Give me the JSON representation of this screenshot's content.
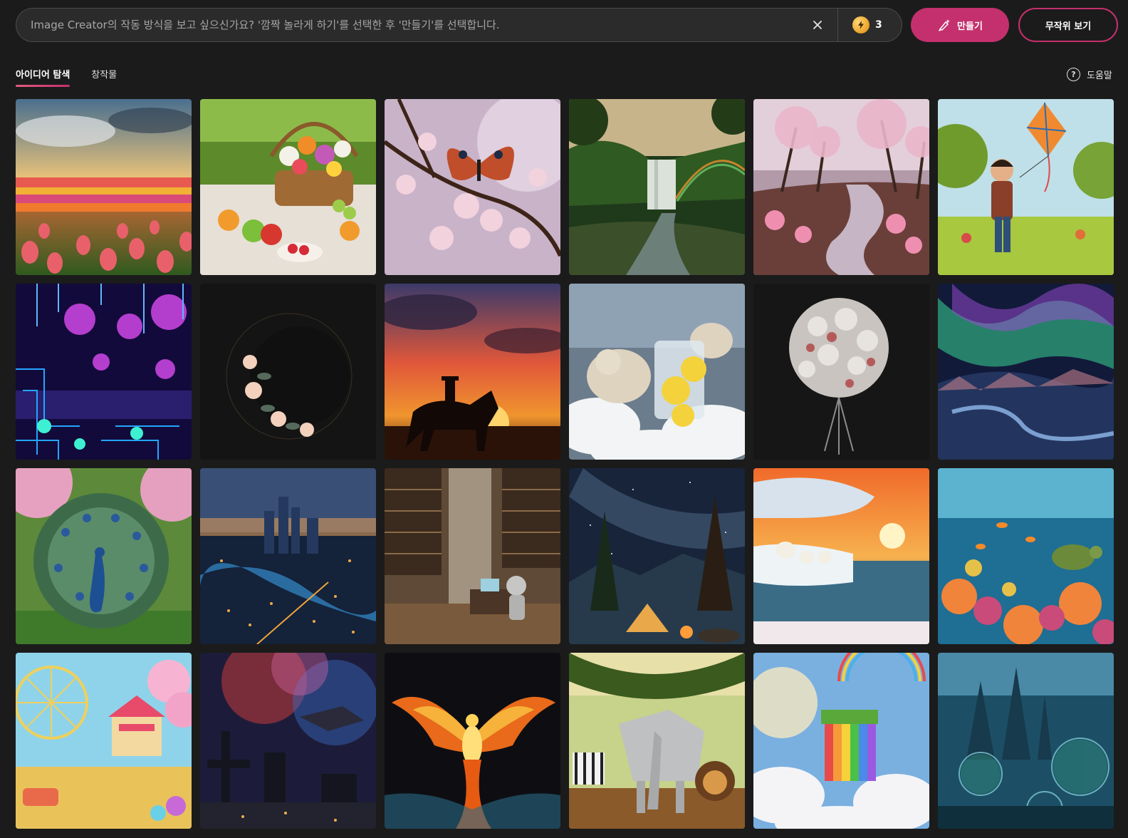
{
  "search": {
    "placeholder": "Image Creator의 작동 방식을 보고 싶으신가요? '깜짝 놀라게 하기'를 선택한 후 '만들기'를 선택합니다.",
    "value": "",
    "clear_icon": "close-icon",
    "boost_icon": "lightning-coin-icon",
    "boost_count": "3"
  },
  "actions": {
    "create_label": "만들기",
    "create_icon": "pen-sparkle-icon",
    "surprise_label": "무작위 보기"
  },
  "tabs": [
    {
      "label": "아이디어 탐색",
      "active": true
    },
    {
      "label": "창작물",
      "active": false
    }
  ],
  "help": {
    "label": "도움말",
    "icon": "question-circle-icon"
  },
  "colors": {
    "background": "#1b1b1b",
    "accent": "#c4306d",
    "bar": "#2b2b2b"
  },
  "gallery": {
    "tiles": [
      {
        "subject": "tulip-field-sunset"
      },
      {
        "subject": "picnic-flower-basket"
      },
      {
        "subject": "butterfly-cherry-blossom"
      },
      {
        "subject": "jungle-waterfall-rainbow"
      },
      {
        "subject": "cherry-blossom-river"
      },
      {
        "subject": "boy-flying-kite"
      },
      {
        "subject": "neon-circuit-garden"
      },
      {
        "subject": "floral-crescent-moon"
      },
      {
        "subject": "cowboy-sunset-silhouette"
      },
      {
        "subject": "polar-bears-lemonade"
      },
      {
        "subject": "metallic-flower-bouquet"
      },
      {
        "subject": "aurora-over-mountains"
      },
      {
        "subject": "peacock-cherry-garden"
      },
      {
        "subject": "city-night-aerial"
      },
      {
        "subject": "robot-library"
      },
      {
        "subject": "milky-way-campsite"
      },
      {
        "subject": "polar-bears-iceberg-sunset"
      },
      {
        "subject": "coral-reef-turtle"
      },
      {
        "subject": "cotton-candy-carnival"
      },
      {
        "subject": "space-city-nebula"
      },
      {
        "subject": "fire-phoenix"
      },
      {
        "subject": "origami-safari-animals"
      },
      {
        "subject": "rainbow-waterfall-clouds"
      },
      {
        "subject": "underwater-city"
      }
    ]
  }
}
